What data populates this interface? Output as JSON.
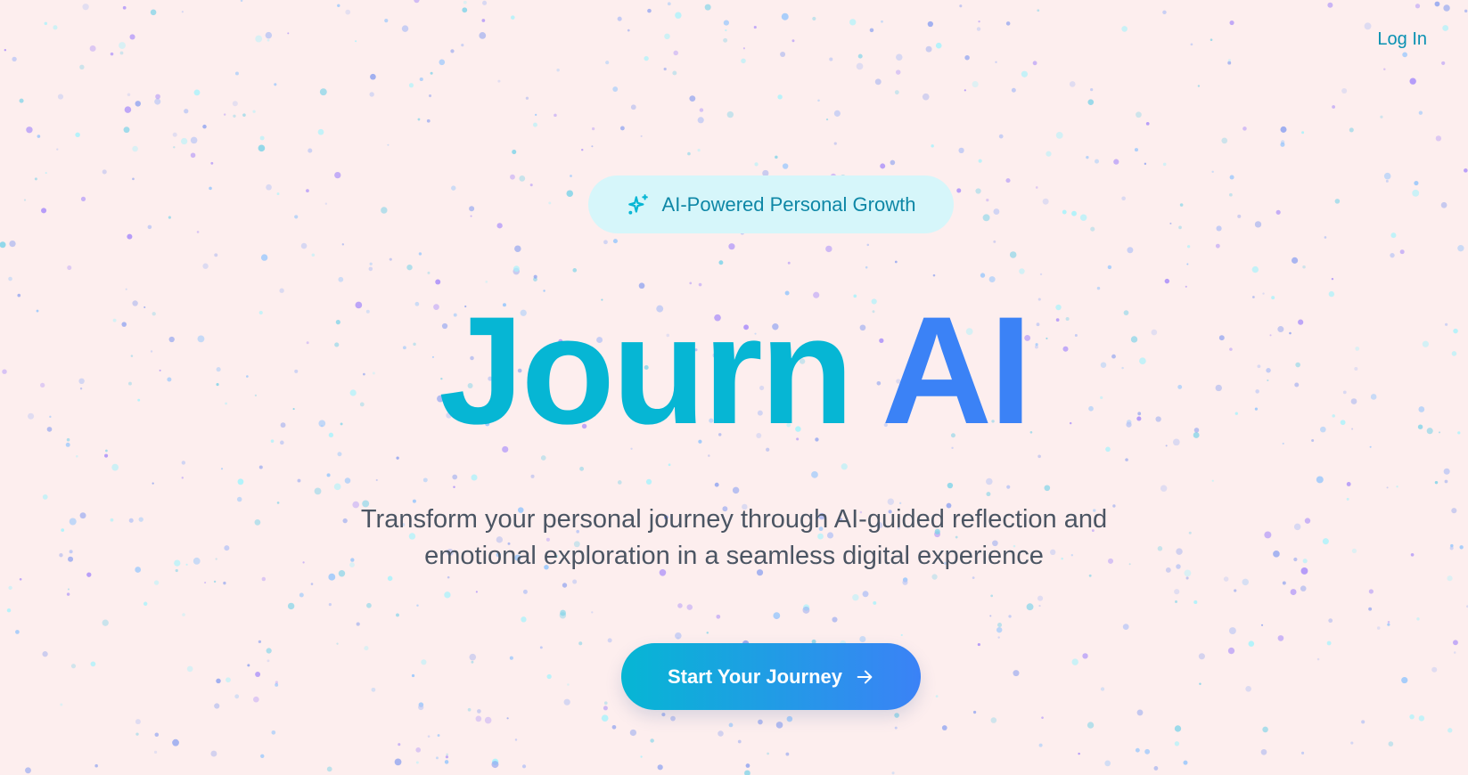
{
  "nav": {
    "login_label": "Log In"
  },
  "hero": {
    "badge_icon": "sparkles-icon",
    "badge_label": "AI-Powered Personal Growth",
    "title_part1": "Journ",
    "title_part2": "AI",
    "subtitle_line1": "Transform your personal journey through AI-guided reflection and",
    "subtitle_line2": "emotional exploration in a seamless digital experience",
    "cta_label": "Start Your Journey",
    "cta_icon": "arrow-right-icon"
  },
  "colors": {
    "background": "#fdeeee",
    "accent_cyan": "#06b6d4",
    "accent_blue": "#3b82f6",
    "badge_bg": "#d6f6fa"
  }
}
